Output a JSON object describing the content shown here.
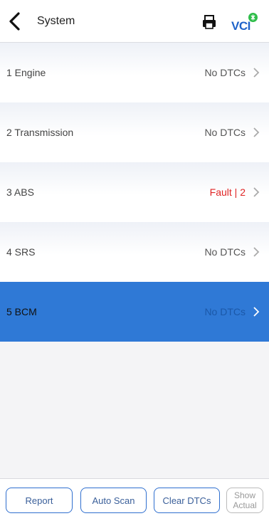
{
  "header": {
    "title": "System",
    "vci_label": "VCI",
    "icons": {
      "back": "back-chevron-icon",
      "print": "print-icon",
      "vci_status": "vci-connected-icon"
    },
    "colors": {
      "vci": "#1e63c9",
      "vci_dot": "#2fbd4a"
    }
  },
  "systems": [
    {
      "label": "1  Engine",
      "status": "No DTCs",
      "state": "ok"
    },
    {
      "label": "2  Transmission",
      "status": "No DTCs",
      "state": "ok"
    },
    {
      "label": "3  ABS",
      "status": "Fault | 2",
      "state": "fault"
    },
    {
      "label": "4  SRS",
      "status": "No DTCs",
      "state": "ok"
    },
    {
      "label": "5  BCM",
      "status": "No DTCs",
      "state": "selected"
    }
  ],
  "footer": {
    "report": "Report",
    "auto_scan": "Auto Scan",
    "clear_dtcs": "Clear DTCs",
    "show_actual_line1": "Show",
    "show_actual_line2": "Actual"
  },
  "colors": {
    "selected_row": "#2f79d6",
    "fault_text": "#e02424",
    "button_border": "#2f6fcf"
  }
}
